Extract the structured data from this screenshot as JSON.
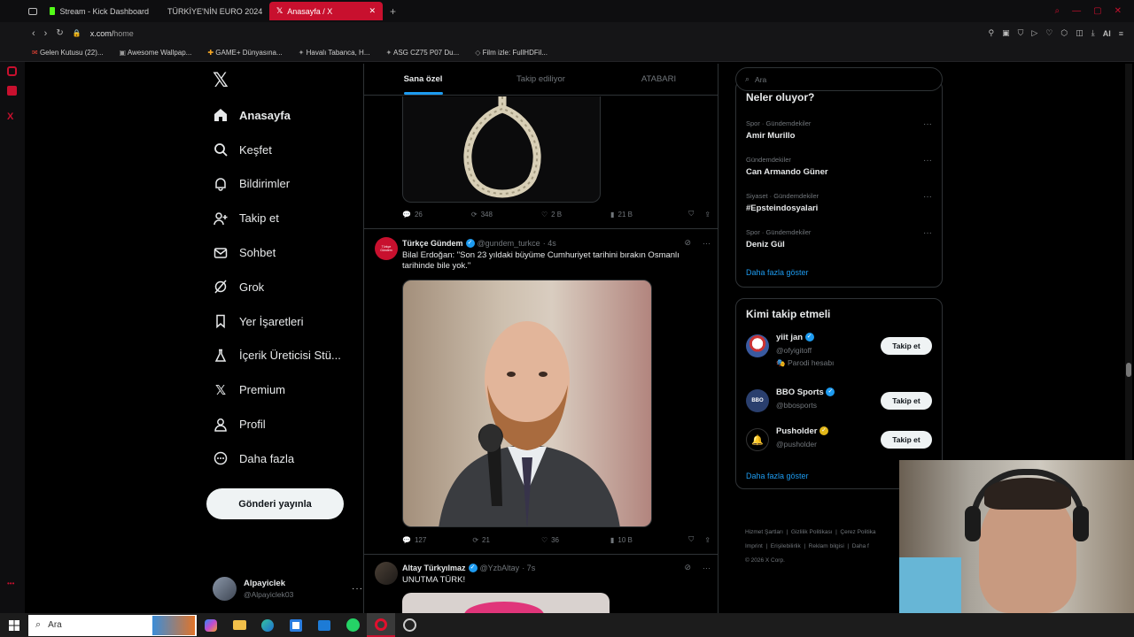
{
  "browser": {
    "tabs": [
      {
        "label": "Stream - Kick Dashboard",
        "color": "#53fc18"
      },
      {
        "label": "TÜRKİYE'NİN EURO 2024",
        "color": "#ff0000"
      },
      {
        "label": "Anasayfa / X",
        "color": "#ffffff"
      }
    ],
    "address": {
      "host": "x.com/",
      "path": "home"
    },
    "bookmarks": [
      "Gelen Kutusu (22)...",
      "Awesome Wallpap...",
      "GAME+ Dünyasına...",
      "Havalı Tabanca, H...",
      "ASG CZ75 P07 Du...",
      "Film izle: FullHDFil..."
    ],
    "ai_label": "AI"
  },
  "nav": {
    "items": [
      {
        "label": "Anasayfa",
        "icon": "home-icon"
      },
      {
        "label": "Keşfet",
        "icon": "search-icon"
      },
      {
        "label": "Bildirimler",
        "icon": "bell-icon"
      },
      {
        "label": "Takip et",
        "icon": "follow-icon"
      },
      {
        "label": "Sohbet",
        "icon": "mail-icon"
      },
      {
        "label": "Grok",
        "icon": "grok-icon"
      },
      {
        "label": "Yer İşaretleri",
        "icon": "bookmark-icon"
      },
      {
        "label": "İçerik Üreticisi Stü...",
        "icon": "creator-icon"
      },
      {
        "label": "Premium",
        "icon": "x-icon"
      },
      {
        "label": "Profil",
        "icon": "profile-icon"
      },
      {
        "label": "Daha fazla",
        "icon": "more-icon"
      }
    ],
    "post_button": "Gönderi yayınla",
    "account": {
      "name": "Alpayiclek",
      "handle": "@Alpayiclek03"
    }
  },
  "feed": {
    "tabs": [
      "Sana özel",
      "Takip ediliyor",
      "ATABARI"
    ],
    "post0": {
      "replies": "26",
      "reposts": "348",
      "likes": "2 B",
      "views": "21 B"
    },
    "post1": {
      "name": "Türkçe Gündem",
      "handle": "@gundem_turkce",
      "time": "· 4s",
      "avatar_text": "Türkçe Gündem",
      "text": "Bilal Erdoğan: \"Son 23 yıldaki büyüme Cumhuriyet tarihini bırakın Osmanlı tarihinde bile yok.\"",
      "replies": "127",
      "reposts": "21",
      "likes": "36",
      "views": "10 B"
    },
    "post2": {
      "name": "Altay Türkyılmaz",
      "handle": "@YzbAltay",
      "time": "· 7s",
      "text": "UNUTMA TÜRK!"
    }
  },
  "sidebar": {
    "search_placeholder": "Ara",
    "trends_title": "Neler oluyor?",
    "trends": [
      {
        "category": "Spor · Gündemdekiler",
        "name": "Amir Murillo"
      },
      {
        "category": "Gündemdekiler",
        "name": "Can Armando Güner"
      },
      {
        "category": "Siyaset · Gündemdekiler",
        "name": "#Epsteindosyalari"
      },
      {
        "category": "Spor · Gündemdekiler",
        "name": "Deniz Gül"
      }
    ],
    "show_more": "Daha fazla göster",
    "who_title": "Kimi takip etmeli",
    "who": [
      {
        "name": "yiit jan",
        "handle": "@ofyigitoff",
        "note": "Parodi hesabı",
        "badge": "blue"
      },
      {
        "name": "BBO Sports",
        "handle": "@bbosports",
        "note": "",
        "badge": "blue"
      },
      {
        "name": "Pusholder",
        "handle": "@pusholder",
        "note": "",
        "badge": "gold"
      }
    ],
    "follow_label": "Takip et",
    "footer": [
      "Hizmet Şartları",
      "Gizlilik Politikası",
      "Çerez Politika",
      "Imprint",
      "Erişilebilirlik",
      "Reklam bilgisi",
      "Daha f",
      "© 2026 X Corp."
    ]
  },
  "taskbar": {
    "search": "Ara"
  }
}
